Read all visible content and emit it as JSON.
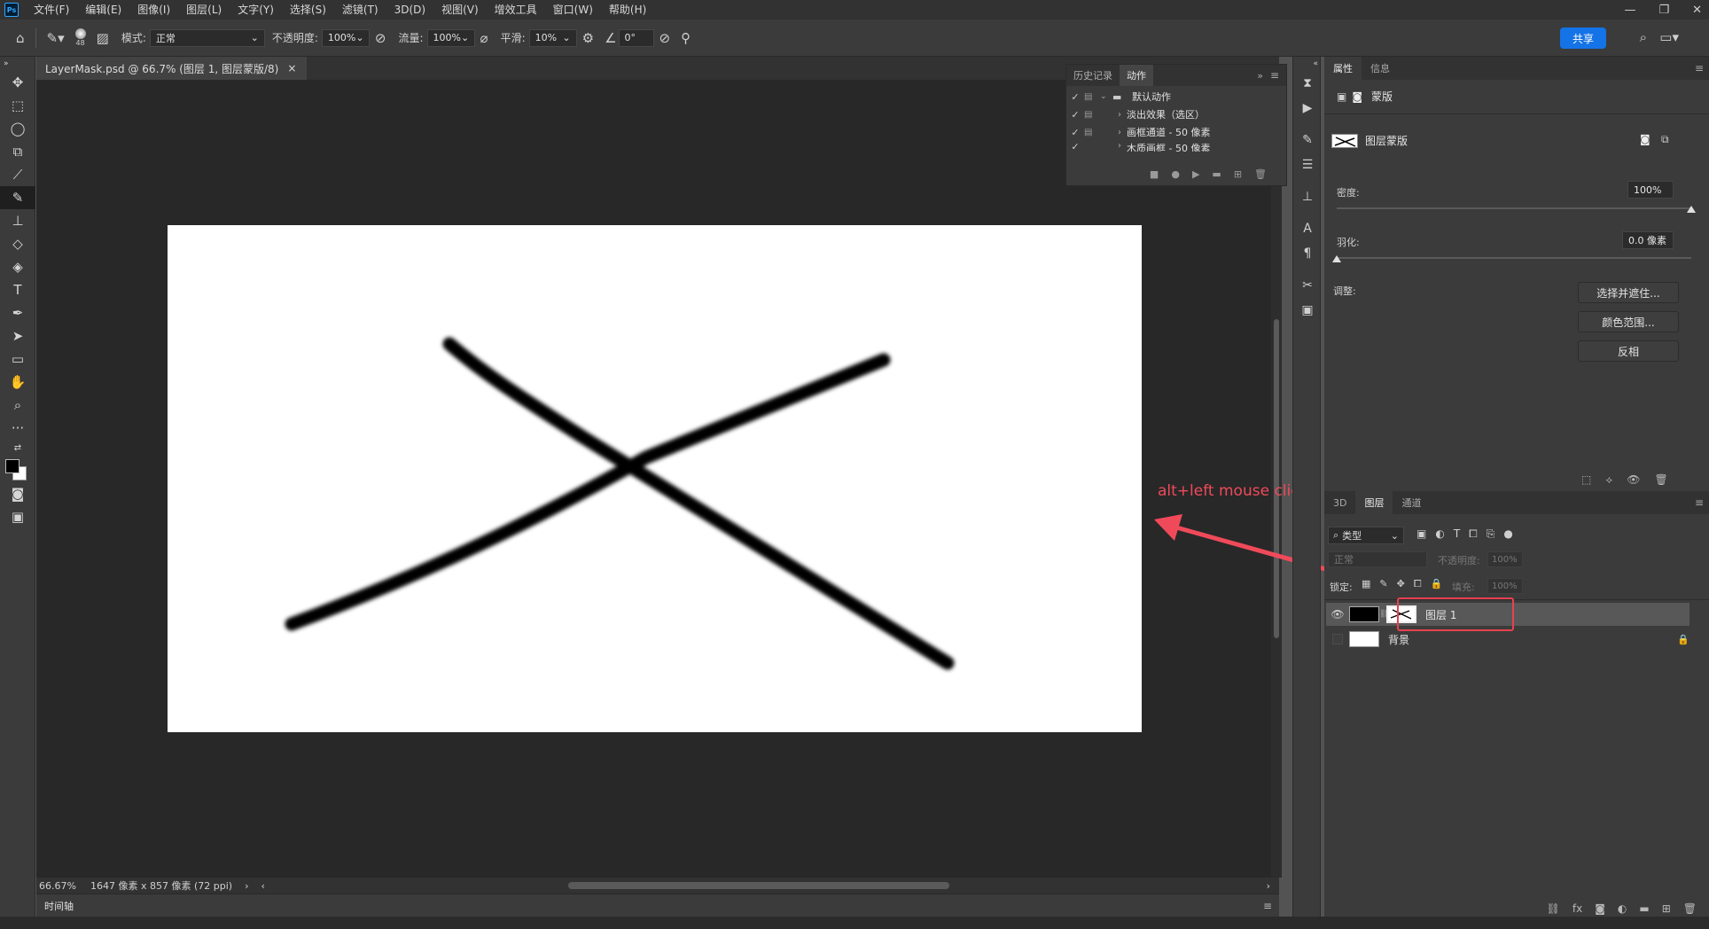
{
  "app": {
    "logo": "Ps",
    "menu": [
      "文件(F)",
      "编辑(E)",
      "图像(I)",
      "图层(L)",
      "文字(Y)",
      "选择(S)",
      "滤镜(T)",
      "3D(D)",
      "视图(V)",
      "增效工具",
      "窗口(W)",
      "帮助(H)"
    ],
    "window_controls": [
      "—",
      "❐",
      "✕"
    ]
  },
  "options_bar": {
    "brush_size": "48",
    "mode_label": "模式:",
    "mode_value": "正常",
    "opacity_label": "不透明度:",
    "opacity_value": "100%",
    "flow_label": "流量:",
    "flow_value": "100%",
    "smooth_label": "平滑:",
    "smooth_value": "10%",
    "angle_value": "0°",
    "share_label": "共享"
  },
  "document": {
    "tab_title": "LayerMask.psd @ 66.7% (图层 1, 图层蒙版/8)",
    "tab_close": "×",
    "zoom": "66.67%",
    "doc_info": "1647 像素 x 857 像素 (72 ppi)",
    "annotation_text": "alt+left mouse click",
    "annotation_color": "#f04a5a",
    "canvas_bg": "#ffffff"
  },
  "timeline": {
    "label": "时间轴"
  },
  "actions_panel": {
    "tabs": [
      "历史记录",
      "动作"
    ],
    "active_tab": "动作",
    "items": [
      {
        "label": "默认动作",
        "type": "set",
        "expanded": true
      },
      {
        "label": "淡出效果（选区）",
        "type": "action"
      },
      {
        "label": "画框通道 - 50 像素",
        "type": "action"
      },
      {
        "label": "木质画框 - 50 像素",
        "type": "action"
      }
    ]
  },
  "properties_panel": {
    "tabs": [
      "属性",
      "信息"
    ],
    "active_tab": "属性",
    "header_label": "蒙版",
    "mask_type_label": "图层蒙版",
    "density_label": "密度:",
    "density_value": "100%",
    "density_level": 1.0,
    "feather_label": "羽化:",
    "feather_value": "0.0 像素",
    "feather_level": 0.0,
    "adjust_label": "调整:",
    "buttons": [
      "选择并遮住...",
      "颜色范围...",
      "反相"
    ]
  },
  "layers_panel": {
    "tabs": [
      "3D",
      "图层",
      "通道"
    ],
    "active_tab": "图层",
    "filter_label": "类型",
    "blend_mode": "正常",
    "opacity_label": "不透明度:",
    "opacity_value": "100%",
    "lock_label": "锁定:",
    "fill_label": "填充:",
    "fill_value": "100%",
    "layers": [
      {
        "name": "图层 1",
        "selected": true,
        "visible": true
      },
      {
        "name": "背景",
        "selected": false,
        "visible": false,
        "locked": true
      }
    ],
    "highlight_color": "#e8414f"
  }
}
